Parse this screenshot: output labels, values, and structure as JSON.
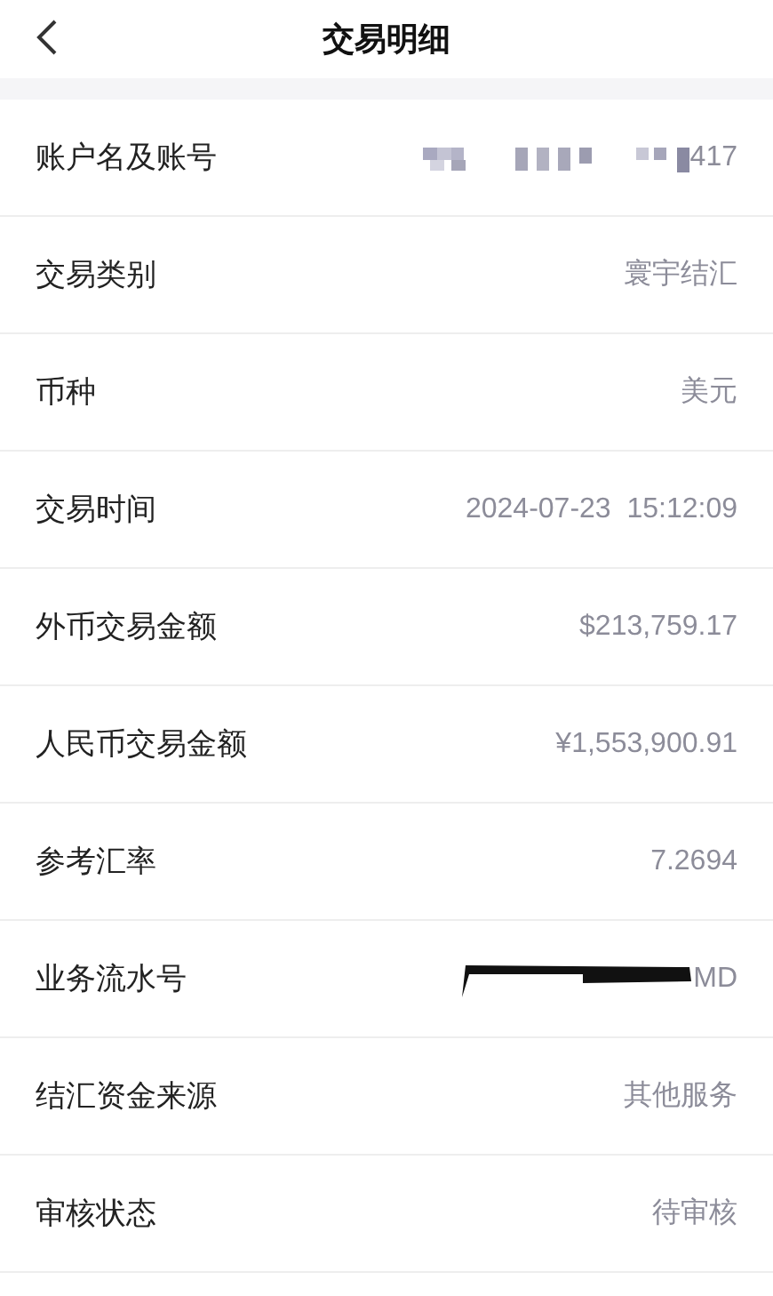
{
  "header": {
    "title": "交易明细"
  },
  "rows": [
    {
      "label": "账户名及账号",
      "kind": "masked",
      "value": "417"
    },
    {
      "label": "交易类别",
      "kind": "text",
      "value": "寰宇结汇"
    },
    {
      "label": "币种",
      "kind": "text",
      "value": "美元"
    },
    {
      "label": "交易时间",
      "kind": "text",
      "value": "2024-07-23  15:12:09"
    },
    {
      "label": "外币交易金额",
      "kind": "text",
      "value": "$213,759.17"
    },
    {
      "label": "人民币交易金额",
      "kind": "text",
      "value": "¥1,553,900.91"
    },
    {
      "label": "参考汇率",
      "kind": "text",
      "value": "7.2694"
    },
    {
      "label": "业务流水号",
      "kind": "scribbled",
      "value": "MD"
    },
    {
      "label": "结汇资金来源",
      "kind": "text",
      "value": "其他服务"
    },
    {
      "label": "审核状态",
      "kind": "text",
      "value": "待审核"
    }
  ]
}
